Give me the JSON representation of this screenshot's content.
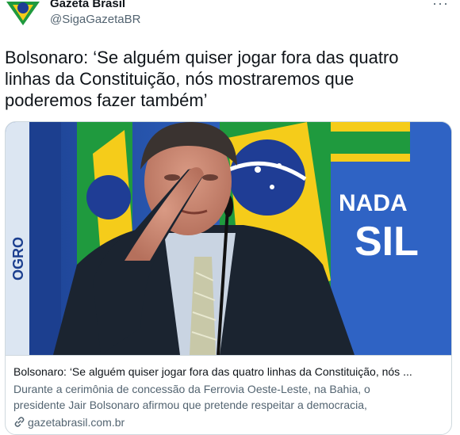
{
  "account": {
    "display_name": "Gazeta Brasil",
    "handle": "@SigaGazetaBR",
    "avatar_icon": "flag-logo-icon"
  },
  "more_icon": "more-icon",
  "tweet": {
    "line1": "Bolsonaro: ‘Se alguém quiser jogar fora das quatro",
    "line2": "linhas da Constituição, nós mostraremos que",
    "line3": "poderemos fazer também’"
  },
  "card": {
    "image_icon": "photo-president-saluting",
    "title": "Bolsonaro: ‘Se alguém quiser jogar fora das quatro linhas da Constituição, nós ...",
    "description_line1": "Durante a cerimônia de concessão da Ferrovia Oeste-Leste, na Bahia, o",
    "description_line2": "presidente Jair Bolsonaro afirmou que pretende respeitar a democracia,",
    "domain": "gazetabrasil.com.br",
    "link_icon": "link-icon",
    "banner_text_line1": "NADA",
    "banner_text_line2": "SIL",
    "banner_text_left": "OGRO"
  },
  "colors": {
    "text": "#0f1419",
    "secondary": "#536471",
    "border": "#cfd9de",
    "flag_green": "#1f9a3e",
    "flag_yellow": "#f5cc1a",
    "flag_blue": "#1f3d95"
  }
}
